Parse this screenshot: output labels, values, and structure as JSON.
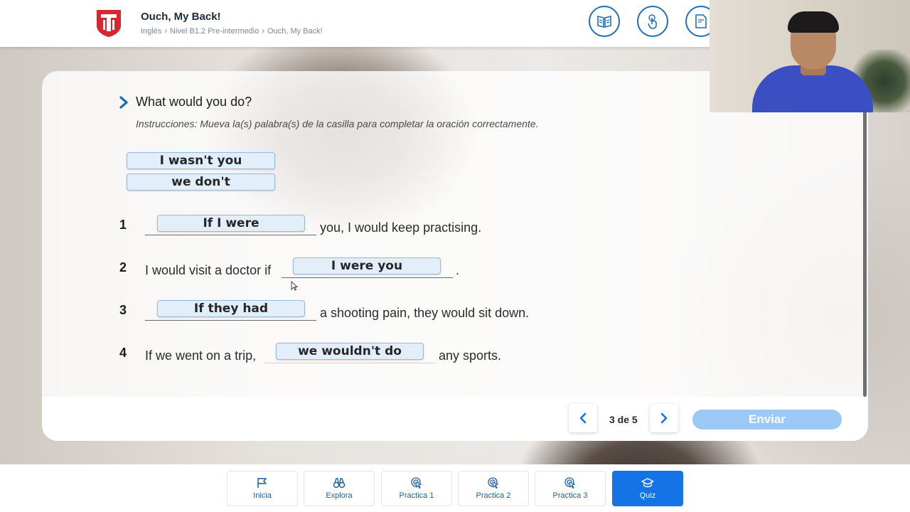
{
  "header": {
    "title": "Ouch, My Back!",
    "breadcrumb": [
      "Inglés",
      "Nivel B1.2 Pre-intermedio",
      "Ouch, My Back!"
    ],
    "brand_color": "#d7282f",
    "accent_color": "#1f6fb8"
  },
  "question": {
    "title": "What would you do?",
    "instructions": "Instrucciones: Mueva la(s) palabra(s) de la casilla para completar la oración correctamente.",
    "word_bank": [
      "I wasn't you",
      "we don't"
    ],
    "items": [
      {
        "number": "1",
        "before": "",
        "answer": "If I were",
        "after": "you, I would keep practising."
      },
      {
        "number": "2",
        "before": "I would visit a doctor if",
        "answer": "I were you",
        "after": "."
      },
      {
        "number": "3",
        "before": "",
        "answer": "If they had",
        "after": "a shooting pain, they would sit down."
      },
      {
        "number": "4",
        "before": "If we went on a trip,",
        "answer": "we wouldn't do",
        "after": "any sports."
      }
    ]
  },
  "pager": {
    "current": "3 de 5",
    "submit_label": "Enviar"
  },
  "bottom_nav": [
    {
      "label": "Inicia",
      "icon": "flag-icon",
      "active": false
    },
    {
      "label": "Explora",
      "icon": "binoculars-icon",
      "active": false
    },
    {
      "label": "Practica 1",
      "icon": "cursor-click-icon",
      "active": false
    },
    {
      "label": "Practica 2",
      "icon": "cursor-click-icon",
      "active": false
    },
    {
      "label": "Practica 3",
      "icon": "cursor-click-icon",
      "active": false
    },
    {
      "label": "Quiz",
      "icon": "graduation-cap-icon",
      "active": true
    }
  ],
  "colors": {
    "active_nav": "#1473e6",
    "submit_disabled": "#9cc8f5",
    "chip_bg": "#e3eefb"
  }
}
